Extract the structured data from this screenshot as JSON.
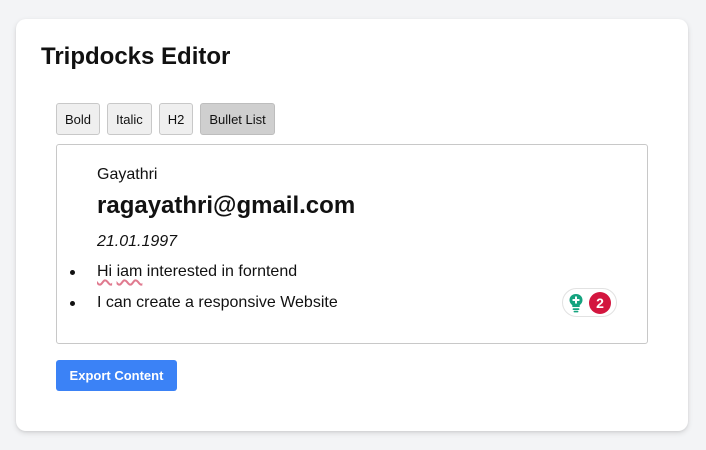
{
  "app": {
    "title": "Tripdocks Editor"
  },
  "toolbar": {
    "buttons": [
      {
        "label": "Bold",
        "active": false
      },
      {
        "label": "Italic",
        "active": false
      },
      {
        "label": "H2",
        "active": false
      },
      {
        "label": "Bullet List",
        "active": true
      }
    ]
  },
  "editor": {
    "name": "Gayathri",
    "email": "ragayathri@gmail.com",
    "date": "21.01.1997",
    "bullets": [
      {
        "parts": [
          "Hi",
          " ",
          "iam",
          " interested in forntend"
        ]
      },
      {
        "parts": [
          "I can create a responsive Website"
        ]
      }
    ],
    "grammar_widget": {
      "icon": "lightbulb-icon",
      "count": "2",
      "badge_color": "#d3163f",
      "icon_color": "#15a37f"
    }
  },
  "actions": {
    "export_label": "Export Content",
    "accent_color": "#3b82f6"
  }
}
